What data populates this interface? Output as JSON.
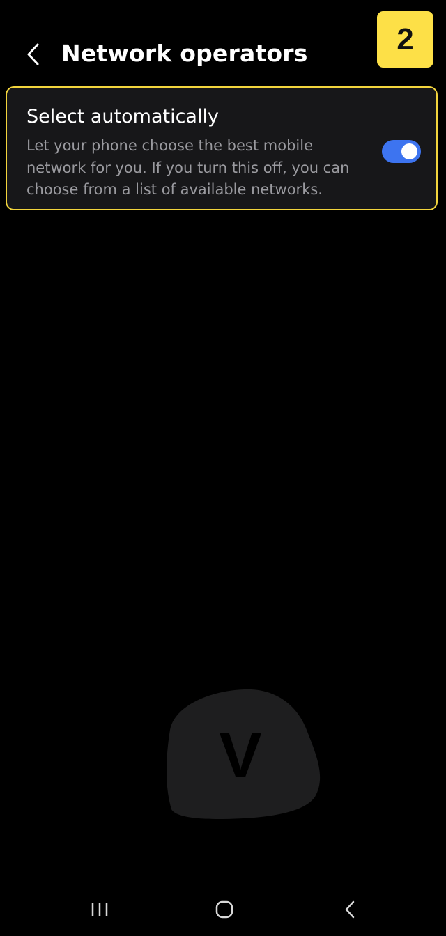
{
  "header": {
    "title": "Network operators",
    "back_icon": "chevron-left-icon"
  },
  "step_badge": {
    "number": "2",
    "color": "#fde047"
  },
  "setting": {
    "title": "Select automatically",
    "description": "Let your phone choose the best mobile network for you. If you turn this off, you can choose from a list of available networks.",
    "toggle_on": true,
    "accent_color": "#3d74f0",
    "highlight_color": "#f2d43d"
  },
  "watermark": {
    "letter": "V"
  },
  "nav_bar": {
    "recents_icon": "recents-icon",
    "home_icon": "home-icon",
    "back_icon": "back-icon"
  }
}
